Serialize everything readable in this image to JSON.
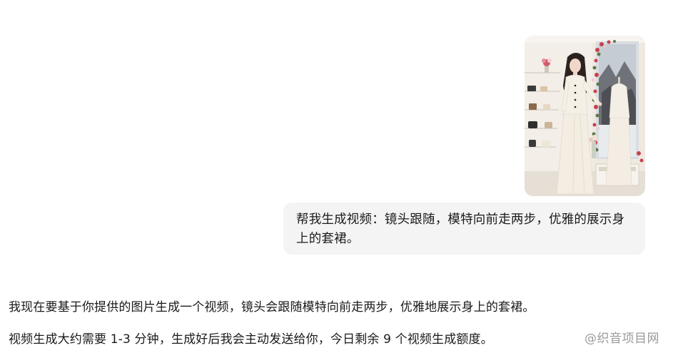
{
  "conversation": {
    "user": {
      "image_alt": "",
      "prompt": "帮我生成视频：镜头跟随，模特向前走两步，优雅的展示身上的套裙。"
    },
    "assistant": {
      "line1": "我现在要基于你提供的图片生成一个视频，镜头会跟随模特向前走两步，优雅地展示身上的套裙。",
      "line2": "视频生成大约需要 1-3 分钟，生成好后我会主动发送给你，今日剩余 9 个视频生成额度。"
    }
  },
  "watermark": "@织音项目网"
}
